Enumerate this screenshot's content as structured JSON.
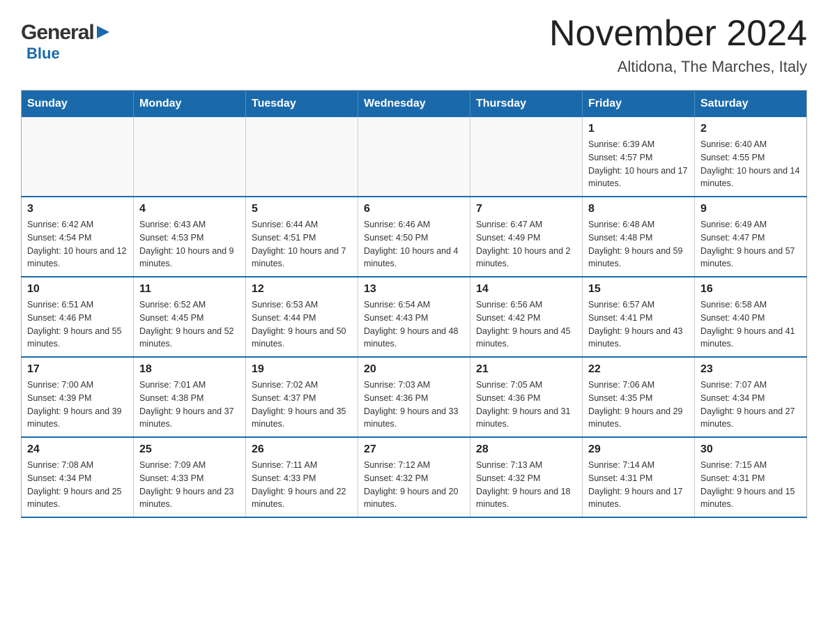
{
  "header": {
    "logo_general": "General",
    "logo_blue": "Blue",
    "main_title": "November 2024",
    "subtitle": "Altidona, The Marches, Italy"
  },
  "weekdays": [
    "Sunday",
    "Monday",
    "Tuesday",
    "Wednesday",
    "Thursday",
    "Friday",
    "Saturday"
  ],
  "weeks": [
    [
      {
        "day": "",
        "info": ""
      },
      {
        "day": "",
        "info": ""
      },
      {
        "day": "",
        "info": ""
      },
      {
        "day": "",
        "info": ""
      },
      {
        "day": "",
        "info": ""
      },
      {
        "day": "1",
        "info": "Sunrise: 6:39 AM\nSunset: 4:57 PM\nDaylight: 10 hours and 17 minutes."
      },
      {
        "day": "2",
        "info": "Sunrise: 6:40 AM\nSunset: 4:55 PM\nDaylight: 10 hours and 14 minutes."
      }
    ],
    [
      {
        "day": "3",
        "info": "Sunrise: 6:42 AM\nSunset: 4:54 PM\nDaylight: 10 hours and 12 minutes."
      },
      {
        "day": "4",
        "info": "Sunrise: 6:43 AM\nSunset: 4:53 PM\nDaylight: 10 hours and 9 minutes."
      },
      {
        "day": "5",
        "info": "Sunrise: 6:44 AM\nSunset: 4:51 PM\nDaylight: 10 hours and 7 minutes."
      },
      {
        "day": "6",
        "info": "Sunrise: 6:46 AM\nSunset: 4:50 PM\nDaylight: 10 hours and 4 minutes."
      },
      {
        "day": "7",
        "info": "Sunrise: 6:47 AM\nSunset: 4:49 PM\nDaylight: 10 hours and 2 minutes."
      },
      {
        "day": "8",
        "info": "Sunrise: 6:48 AM\nSunset: 4:48 PM\nDaylight: 9 hours and 59 minutes."
      },
      {
        "day": "9",
        "info": "Sunrise: 6:49 AM\nSunset: 4:47 PM\nDaylight: 9 hours and 57 minutes."
      }
    ],
    [
      {
        "day": "10",
        "info": "Sunrise: 6:51 AM\nSunset: 4:46 PM\nDaylight: 9 hours and 55 minutes."
      },
      {
        "day": "11",
        "info": "Sunrise: 6:52 AM\nSunset: 4:45 PM\nDaylight: 9 hours and 52 minutes."
      },
      {
        "day": "12",
        "info": "Sunrise: 6:53 AM\nSunset: 4:44 PM\nDaylight: 9 hours and 50 minutes."
      },
      {
        "day": "13",
        "info": "Sunrise: 6:54 AM\nSunset: 4:43 PM\nDaylight: 9 hours and 48 minutes."
      },
      {
        "day": "14",
        "info": "Sunrise: 6:56 AM\nSunset: 4:42 PM\nDaylight: 9 hours and 45 minutes."
      },
      {
        "day": "15",
        "info": "Sunrise: 6:57 AM\nSunset: 4:41 PM\nDaylight: 9 hours and 43 minutes."
      },
      {
        "day": "16",
        "info": "Sunrise: 6:58 AM\nSunset: 4:40 PM\nDaylight: 9 hours and 41 minutes."
      }
    ],
    [
      {
        "day": "17",
        "info": "Sunrise: 7:00 AM\nSunset: 4:39 PM\nDaylight: 9 hours and 39 minutes."
      },
      {
        "day": "18",
        "info": "Sunrise: 7:01 AM\nSunset: 4:38 PM\nDaylight: 9 hours and 37 minutes."
      },
      {
        "day": "19",
        "info": "Sunrise: 7:02 AM\nSunset: 4:37 PM\nDaylight: 9 hours and 35 minutes."
      },
      {
        "day": "20",
        "info": "Sunrise: 7:03 AM\nSunset: 4:36 PM\nDaylight: 9 hours and 33 minutes."
      },
      {
        "day": "21",
        "info": "Sunrise: 7:05 AM\nSunset: 4:36 PM\nDaylight: 9 hours and 31 minutes."
      },
      {
        "day": "22",
        "info": "Sunrise: 7:06 AM\nSunset: 4:35 PM\nDaylight: 9 hours and 29 minutes."
      },
      {
        "day": "23",
        "info": "Sunrise: 7:07 AM\nSunset: 4:34 PM\nDaylight: 9 hours and 27 minutes."
      }
    ],
    [
      {
        "day": "24",
        "info": "Sunrise: 7:08 AM\nSunset: 4:34 PM\nDaylight: 9 hours and 25 minutes."
      },
      {
        "day": "25",
        "info": "Sunrise: 7:09 AM\nSunset: 4:33 PM\nDaylight: 9 hours and 23 minutes."
      },
      {
        "day": "26",
        "info": "Sunrise: 7:11 AM\nSunset: 4:33 PM\nDaylight: 9 hours and 22 minutes."
      },
      {
        "day": "27",
        "info": "Sunrise: 7:12 AM\nSunset: 4:32 PM\nDaylight: 9 hours and 20 minutes."
      },
      {
        "day": "28",
        "info": "Sunrise: 7:13 AM\nSunset: 4:32 PM\nDaylight: 9 hours and 18 minutes."
      },
      {
        "day": "29",
        "info": "Sunrise: 7:14 AM\nSunset: 4:31 PM\nDaylight: 9 hours and 17 minutes."
      },
      {
        "day": "30",
        "info": "Sunrise: 7:15 AM\nSunset: 4:31 PM\nDaylight: 9 hours and 15 minutes."
      }
    ]
  ]
}
